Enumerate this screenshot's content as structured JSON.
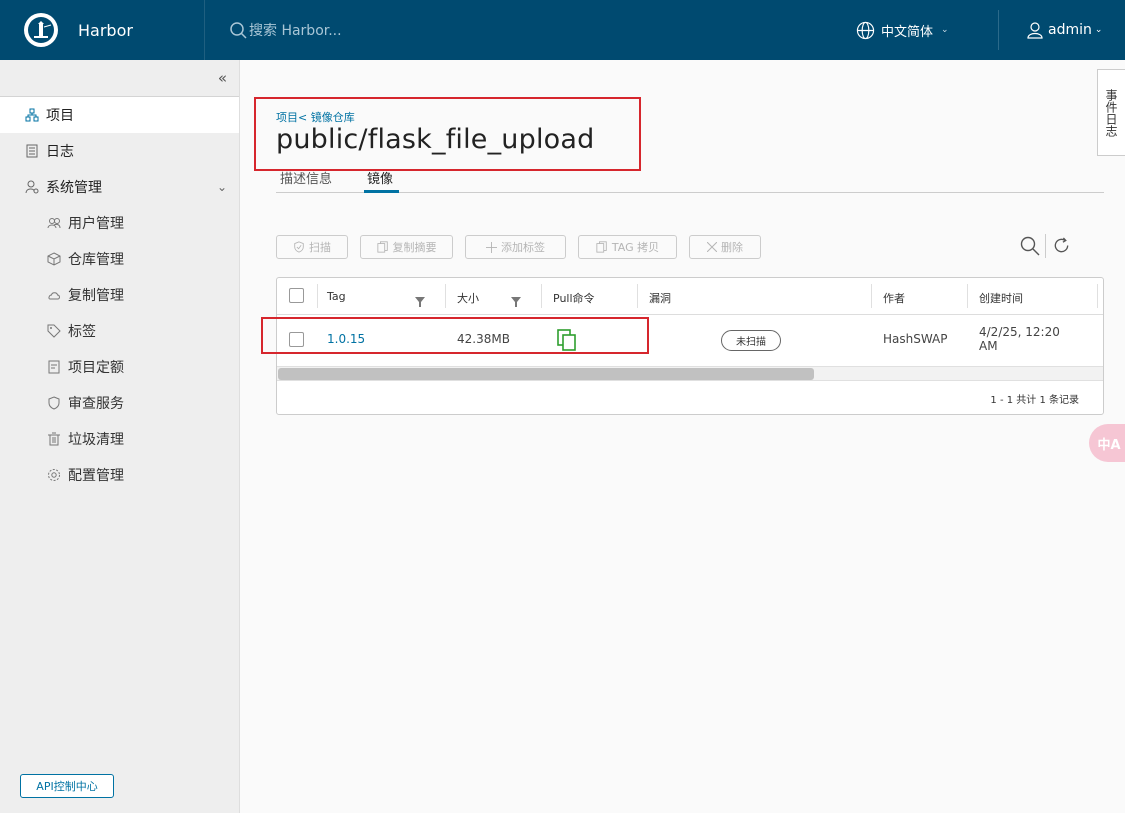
{
  "header": {
    "app_name": "Harbor",
    "search_placeholder": "搜索 Harbor...",
    "language": "中文简体",
    "user": "admin"
  },
  "sidebar": {
    "items": [
      {
        "label": "项目",
        "icon": "projects-icon",
        "active": true
      },
      {
        "label": "日志",
        "icon": "logs-icon"
      },
      {
        "label": "系统管理",
        "icon": "admin-icon",
        "expanded": true
      }
    ],
    "sub_items": [
      {
        "label": "用户管理",
        "icon": "users-icon"
      },
      {
        "label": "仓库管理",
        "icon": "registry-icon"
      },
      {
        "label": "复制管理",
        "icon": "replication-icon"
      },
      {
        "label": "标签",
        "icon": "tag-icon"
      },
      {
        "label": "项目定额",
        "icon": "quota-icon"
      },
      {
        "label": "审查服务",
        "icon": "shield-icon"
      },
      {
        "label": "垃圾清理",
        "icon": "trash-icon"
      },
      {
        "label": "配置管理",
        "icon": "gear-icon"
      }
    ],
    "api_button": "API控制中心"
  },
  "main": {
    "breadcrumb": "项目< 镜像仓库",
    "title": "public/flask_file_upload",
    "tabs": [
      {
        "label": "描述信息"
      },
      {
        "label": "镜像",
        "active": true
      }
    ],
    "toolbar": {
      "scan": "扫描",
      "copy_digest": "复制摘要",
      "add_label": "添加标签",
      "tag_copy": "TAG 拷贝",
      "delete": "删除"
    },
    "table": {
      "columns": [
        "Tag",
        "大小",
        "Pull命令",
        "漏洞",
        "作者",
        "创建时间"
      ],
      "rows": [
        {
          "tag": "1.0.15",
          "size": "42.38MB",
          "vulnerability": "未扫描",
          "author": "HashSWAP",
          "created_line1": "4/2/25, 12:20",
          "created_line2": "AM"
        }
      ],
      "footer": "1 - 1 共计 1 条记录"
    }
  },
  "drawer": {
    "label": "事件日志"
  },
  "translate_icon": "中A",
  "colors": {
    "header_bg": "#004a70",
    "accent": "#0072a3",
    "highlight_box": "#d6262d",
    "pull_icon": "#2e9e2e"
  }
}
